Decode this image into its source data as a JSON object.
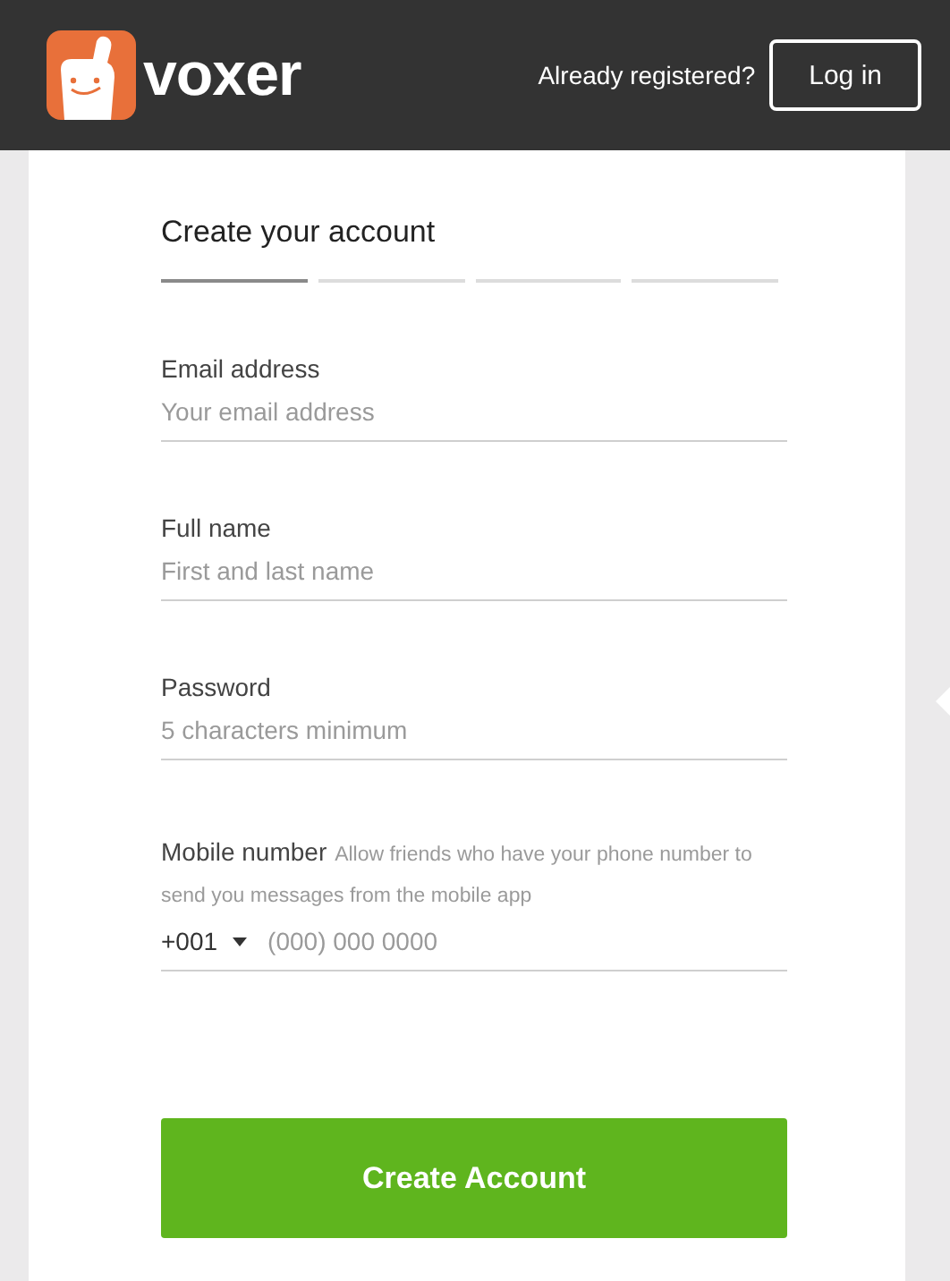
{
  "header": {
    "logo_text": "voxer",
    "prompt": "Already registered?",
    "login_button": "Log in"
  },
  "form": {
    "title": "Create your account",
    "steps": [
      {
        "selected": true
      },
      {
        "selected": false
      },
      {
        "selected": false
      },
      {
        "selected": false
      }
    ],
    "fields": [
      {
        "kind": "text",
        "label": "Email address",
        "placeholder": "Your email address"
      },
      {
        "kind": "text",
        "label": "Full name",
        "placeholder": "First and last name"
      },
      {
        "kind": "text",
        "label": "Password",
        "placeholder": "5 characters minimum"
      },
      {
        "kind": "phone",
        "label": "Mobile number",
        "hint": "Allow friends who have your phone number to send you messages from the mobile app",
        "country_code": "+001",
        "placeholder": "(000) 000 0000"
      }
    ],
    "submit": "Create Account"
  }
}
